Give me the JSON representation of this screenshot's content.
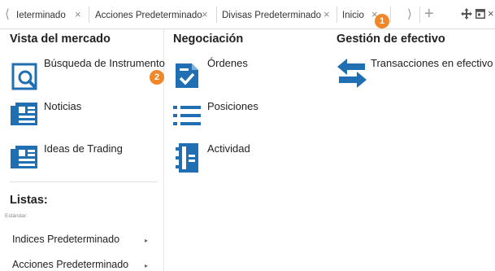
{
  "tabs": [
    {
      "label": "Ieterminado"
    },
    {
      "label": "Acciones Predeterminado"
    },
    {
      "label": "Divisas Predeterminado"
    },
    {
      "label": "Inicio"
    }
  ],
  "tab_close_glyph": "×",
  "tab_prev_glyph": "⟨",
  "tab_next_glyph": "⟩",
  "add_glyph": "+",
  "badges": {
    "one": "1",
    "two": "2"
  },
  "accent_color": "#1f6fb2",
  "badge_color": "#f0882a",
  "columns": {
    "market": {
      "title": "Vista del mercado",
      "items": [
        {
          "label": "Búsqueda de Instrumento",
          "icon": "search-document-icon"
        },
        {
          "label": "Noticias",
          "icon": "newspaper-icon"
        },
        {
          "label": "Ideas de Trading",
          "icon": "newspaper-icon"
        }
      ]
    },
    "trading": {
      "title": "Negociación",
      "items": [
        {
          "label": "Órdenes",
          "icon": "orders-check-icon"
        },
        {
          "label": "Posiciones",
          "icon": "list-icon"
        },
        {
          "label": "Actividad",
          "icon": "activity-book-icon"
        }
      ]
    },
    "cash": {
      "title": "Gestión de efectivo",
      "items": [
        {
          "label": "Transacciones en efectivo",
          "icon": "transfer-arrows-icon"
        }
      ]
    }
  },
  "lists": {
    "title": "Listas:",
    "subtitle": "Estándar:",
    "items": [
      {
        "label": "Indices Predeterminado"
      },
      {
        "label": "Acciones Predeterminado"
      }
    ],
    "arrow_glyph": "▸"
  }
}
